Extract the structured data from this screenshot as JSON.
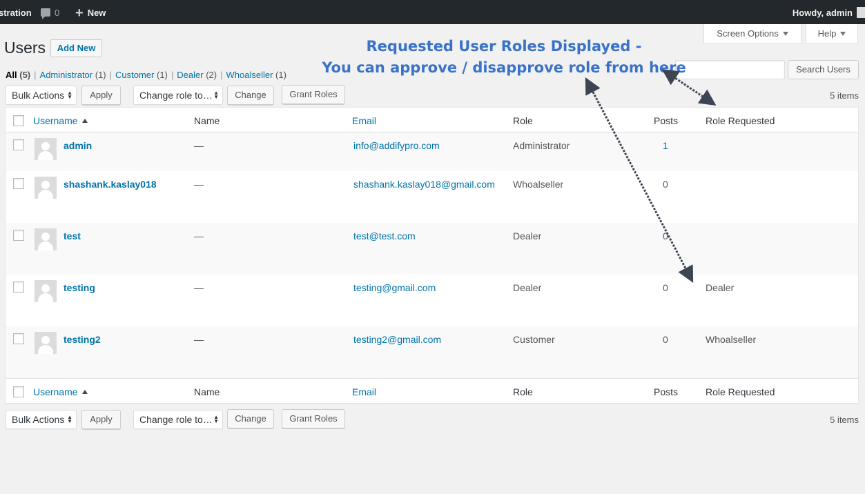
{
  "adminbar": {
    "site_name": "stration",
    "comments_count": "0",
    "new_label": "New",
    "howdy": "Howdy, admin"
  },
  "screen_meta": {
    "screen_options": "Screen Options",
    "help": "Help"
  },
  "page": {
    "title": "Users",
    "add_new": "Add New"
  },
  "filters": [
    {
      "label": "All",
      "count": "(5)"
    },
    {
      "label": "Administrator",
      "count": "(1)"
    },
    {
      "label": "Customer",
      "count": "(1)"
    },
    {
      "label": "Dealer",
      "count": "(2)"
    },
    {
      "label": "Whoalseller",
      "count": "(1)"
    }
  ],
  "search": {
    "placeholder": "",
    "button": "Search Users"
  },
  "tablenav": {
    "bulk_actions": "Bulk Actions",
    "apply": "Apply",
    "change_role": "Change role to…",
    "change": "Change",
    "grant_roles": "Grant Roles",
    "items_count": "5 items"
  },
  "columns": {
    "username": "Username",
    "name": "Name",
    "email": "Email",
    "role": "Role",
    "posts": "Posts",
    "role_requested": "Role Requested"
  },
  "users": [
    {
      "username": "admin",
      "name": "—",
      "email": "info@addifypro.com",
      "role": "Administrator",
      "posts": "1",
      "role_requested": ""
    },
    {
      "username": "shashank.kaslay018",
      "name": "—",
      "email": "shashank.kaslay018@gmail.com",
      "role": "Whoalseller",
      "posts": "0",
      "role_requested": ""
    },
    {
      "username": "test",
      "name": "—",
      "email": "test@test.com",
      "role": "Dealer",
      "posts": "0",
      "role_requested": ""
    },
    {
      "username": "testing",
      "name": "—",
      "email": "testing@gmail.com",
      "role": "Dealer",
      "posts": "0",
      "role_requested": "Dealer"
    },
    {
      "username": "testing2",
      "name": "—",
      "email": "testing2@gmail.com",
      "role": "Customer",
      "posts": "0",
      "role_requested": "Whoalseller"
    }
  ],
  "annotation": {
    "line1": "Requested User Roles Displayed -",
    "line2": "You can approve / disapprove role from here",
    "color": "#3a72c8"
  }
}
